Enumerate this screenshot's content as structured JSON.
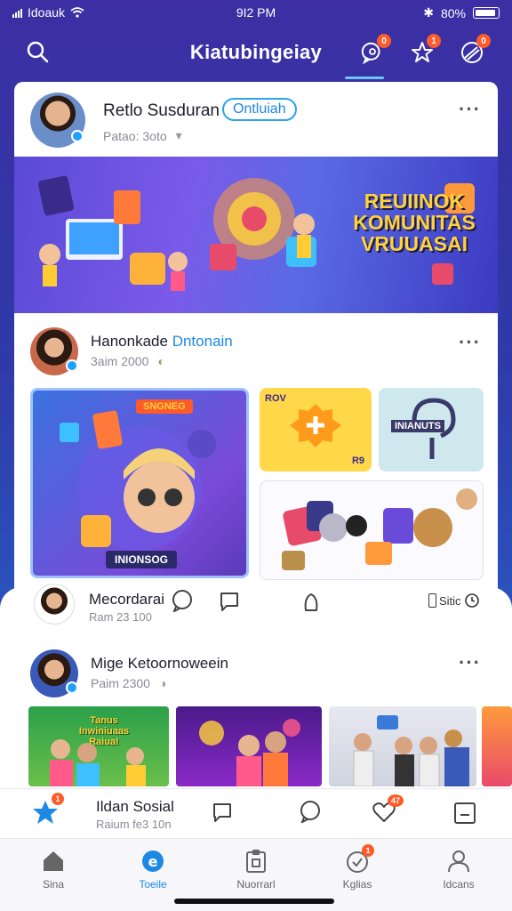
{
  "status_bar": {
    "carrier": "Idoauk",
    "time": "9I2 PM",
    "battery": "80%"
  },
  "header": {
    "title": "Kiatubingeiay",
    "badges": [
      "0",
      "1",
      "0"
    ],
    "icons": [
      "search-icon",
      "chat-bubble-icon",
      "star-icon",
      "compass-icon"
    ],
    "accent": "#6cc5ff"
  },
  "post1": {
    "author": "Retlo Susduran",
    "follow_label": "Ontluiah",
    "meta": "Patao: 3oto",
    "banner_title": "REUIINOK KOMUNITAS VRUUASAI"
  },
  "post2": {
    "author_first": "Hanonkade",
    "author_second": "Dntonain",
    "meta": "3aim 2000",
    "tile_label_top": "SNGNEG",
    "tile_label_bottom": "INIONSOG",
    "small_tile_1": "ROV",
    "small_tile_1_b": "R9",
    "small_tile_2": "INIANUTS"
  },
  "actions": {
    "author": "Mecordarai",
    "meta": "Ram 23 100",
    "share_label": "Sitic"
  },
  "post3": {
    "author": "Mige Ketoornoweein",
    "meta": "Paim 2300",
    "thumb1_text": "Tanus Inwiniuaas Raiua!"
  },
  "bottom_post": {
    "title": "Ildan Sosial",
    "meta": "Raium fe3 10n",
    "badge_left": "1",
    "badge_right": "47"
  },
  "nav": {
    "items": [
      {
        "label": "Sina",
        "icon": "home-icon"
      },
      {
        "label": "Toeile",
        "icon": "explore-icon"
      },
      {
        "label": "Nuorrarl",
        "icon": "clipboard-icon"
      },
      {
        "label": "Kglias",
        "icon": "bell-icon",
        "badge": "1"
      },
      {
        "label": "Idcans",
        "icon": "profile-icon"
      }
    ],
    "active_index": 1,
    "active_color": "#1e88e5"
  }
}
